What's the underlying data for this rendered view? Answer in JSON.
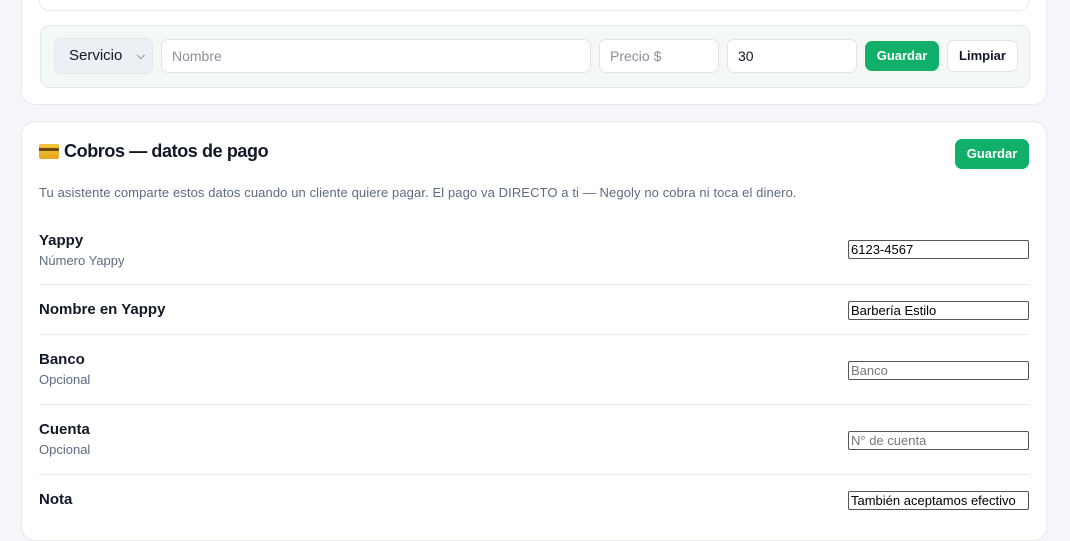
{
  "service_form": {
    "type_select": "Servicio",
    "name_placeholder": "Nombre",
    "price_placeholder": "Precio $",
    "duration_value": "30",
    "save_label": "Guardar",
    "clear_label": "Limpiar"
  },
  "cobros": {
    "title": "Cobros — datos de pago",
    "icon": "credit-card-icon",
    "save_label": "Guardar",
    "description": "Tu asistente comparte estos datos cuando un cliente quiere pagar. El pago va DIRECTO a ti — Negoly no cobra ni toca el dinero.",
    "fields": [
      {
        "label": "Yappy",
        "sublabel": "Número Yappy",
        "value": "6123-4567",
        "placeholder": ""
      },
      {
        "label": "Nombre en Yappy",
        "sublabel": "",
        "value": "Barbería Estilo",
        "placeholder": ""
      },
      {
        "label": "Banco",
        "sublabel": "Opcional",
        "value": "",
        "placeholder": "Banco"
      },
      {
        "label": "Cuenta",
        "sublabel": "Opcional",
        "value": "",
        "placeholder": "N° de cuenta"
      },
      {
        "label": "Nota",
        "sublabel": "",
        "value": "También aceptamos efectivo",
        "placeholder": ""
      }
    ]
  },
  "colors": {
    "accent": "#10b06a",
    "page_bg": "#f4f6fa",
    "muted_text": "#5c6b82"
  }
}
